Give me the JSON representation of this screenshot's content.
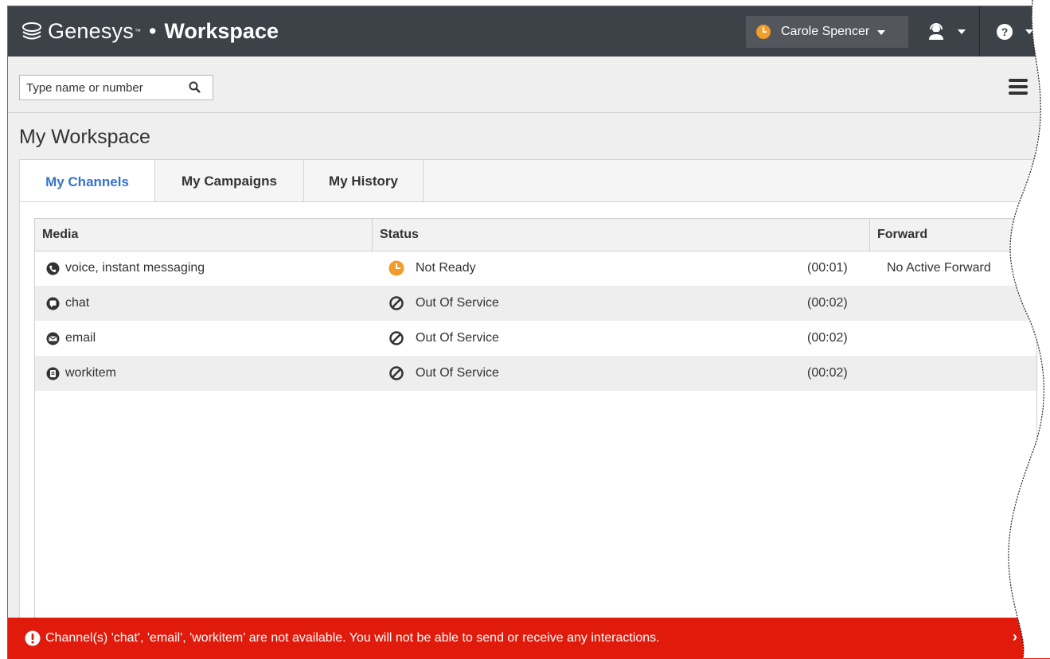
{
  "app": {
    "brand_name": "Genesys",
    "brand_tm": "™",
    "brand_separator": "•",
    "product_name": "Workspace"
  },
  "topbar": {
    "agent_name": "Carole Spencer",
    "agent_status_color": "#f39c2b"
  },
  "search": {
    "placeholder": "Type name or number"
  },
  "page": {
    "title": "My Workspace"
  },
  "tabs": [
    {
      "label": "My Channels",
      "active": true
    },
    {
      "label": "My Campaigns",
      "active": false
    },
    {
      "label": "My History",
      "active": false
    }
  ],
  "table": {
    "columns": [
      "Media",
      "Status",
      "Forward"
    ],
    "rows": [
      {
        "media": "voice, instant messaging",
        "media_icon": "voice-im-icon",
        "status": "Not Ready",
        "status_icon": "not-ready-clock-icon",
        "duration": "(00:01)",
        "forward": "No Active Forward"
      },
      {
        "media": "chat",
        "media_icon": "chat-icon",
        "status": "Out Of Service",
        "status_icon": "out-of-service-icon",
        "duration": "(00:02)",
        "forward": ""
      },
      {
        "media": "email",
        "media_icon": "email-icon",
        "status": "Out Of Service",
        "status_icon": "out-of-service-icon",
        "duration": "(00:02)",
        "forward": ""
      },
      {
        "media": "workitem",
        "media_icon": "workitem-icon",
        "status": "Out Of Service",
        "status_icon": "out-of-service-icon",
        "duration": "(00:02)",
        "forward": ""
      }
    ]
  },
  "banner": {
    "message": "Channel(s) 'chat', 'email', 'workitem' are not available. You will not be able to send or receive any interactions.",
    "close_glyph": "›",
    "color": "#e11b0c"
  },
  "colors": {
    "topbar": "#3d4249",
    "active_tab": "#3873cc",
    "not_ready": "#f39c2b"
  }
}
